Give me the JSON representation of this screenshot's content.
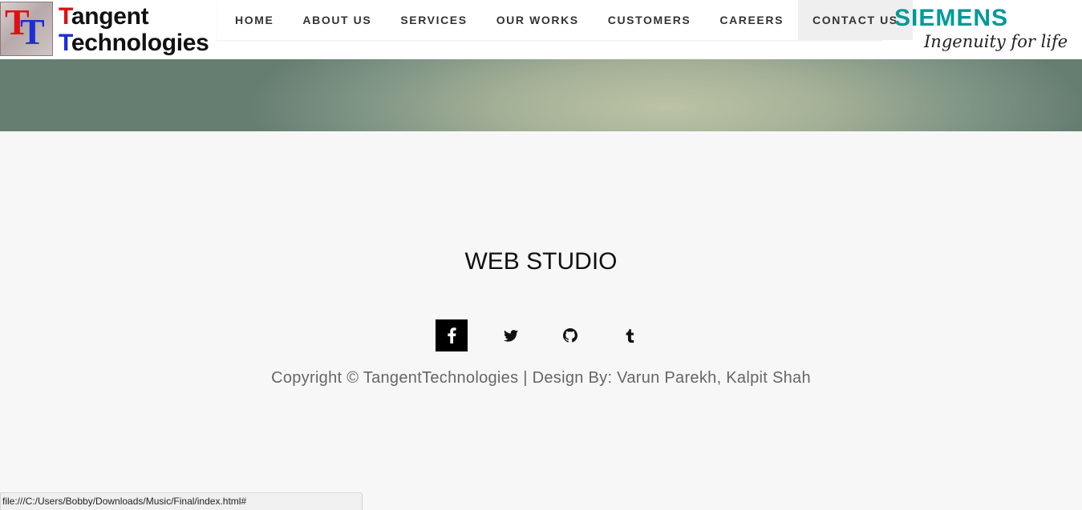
{
  "brand": {
    "logo_letters": "TT",
    "name_line1": "Tangent",
    "name_line2": "Technologies"
  },
  "nav": {
    "items": [
      {
        "label": "HOME"
      },
      {
        "label": "ABOUT US"
      },
      {
        "label": "SERVICES"
      },
      {
        "label": "OUR WORKS"
      },
      {
        "label": "CUSTOMERS"
      },
      {
        "label": "CAREERS"
      },
      {
        "label": "CONTACT US",
        "active": true
      }
    ]
  },
  "partner": {
    "name": "SIEMENS",
    "tagline": "Ingenuity for life",
    "color": "#009999"
  },
  "footer": {
    "title": "WEB STUDIO",
    "socials": [
      {
        "icon": "facebook-icon"
      },
      {
        "icon": "twitter-icon"
      },
      {
        "icon": "github-icon"
      },
      {
        "icon": "tumblr-icon"
      }
    ],
    "copyright": "Copyright © TangentTechnologies | Design By: Varun Parekh, Kalpit Shah"
  },
  "status_bar": {
    "url": "file:///C:/Users/Bobby/Downloads/Music/Final/index.html#"
  },
  "colors": {
    "background": "#f7f7f7",
    "nav_active_bg": "#efefef",
    "brand_red": "#dd1111",
    "brand_blue": "#1a2fd6"
  }
}
